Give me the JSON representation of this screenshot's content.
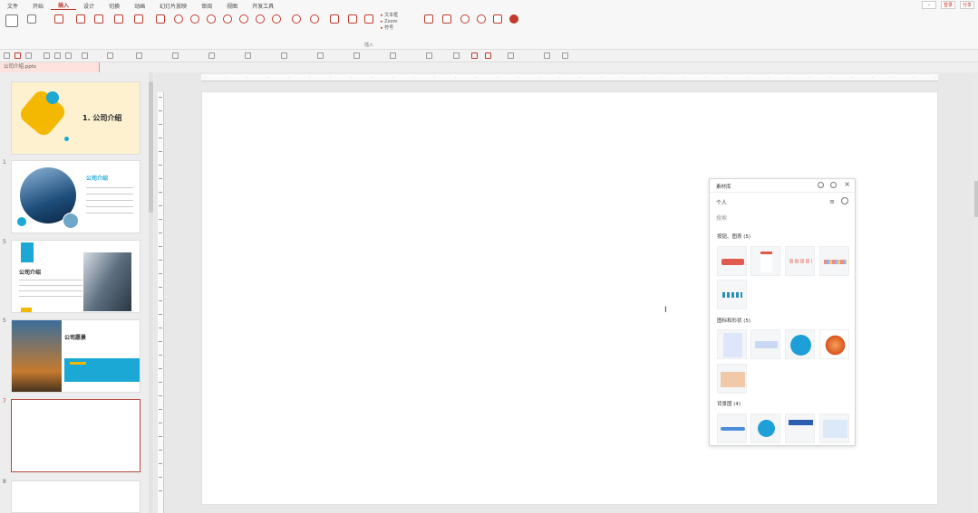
{
  "menubar": {
    "items": [
      "文件",
      "开始",
      "插入",
      "设计",
      "切换",
      "动画",
      "幻灯片放映",
      "审阅",
      "视图",
      "开发工具"
    ],
    "active_index": 2,
    "window_buttons": [
      "登录",
      "分享"
    ]
  },
  "ribbon": {
    "group_labels": [
      "插入"
    ],
    "small_buttons": [
      "文本框",
      "Zoom",
      "符号"
    ]
  },
  "document": {
    "tab_title": "公司介绍.pptx"
  },
  "slides": [
    {
      "number": "",
      "title": "1. 公司介绍"
    },
    {
      "number": "1",
      "title": "公司介绍"
    },
    {
      "number": "5",
      "title": "公司介绍"
    },
    {
      "number": "5",
      "title": "公司愿景"
    },
    {
      "number": "7",
      "title": ""
    },
    {
      "number": "8",
      "title": ""
    }
  ],
  "panel": {
    "title": "素材库",
    "tabs": [
      "个人"
    ],
    "search_placeholder": "搜索",
    "sections": [
      {
        "title": "按钮、图表 (5)"
      },
      {
        "title": "图标和形状 (5)"
      },
      {
        "title": "背景图 (4)"
      }
    ]
  },
  "colors": {
    "accent": "#c0392b",
    "slide_yellow": "#f5b800",
    "slide_blue": "#1ba8d5",
    "slide_cream": "#fdf1d0"
  }
}
